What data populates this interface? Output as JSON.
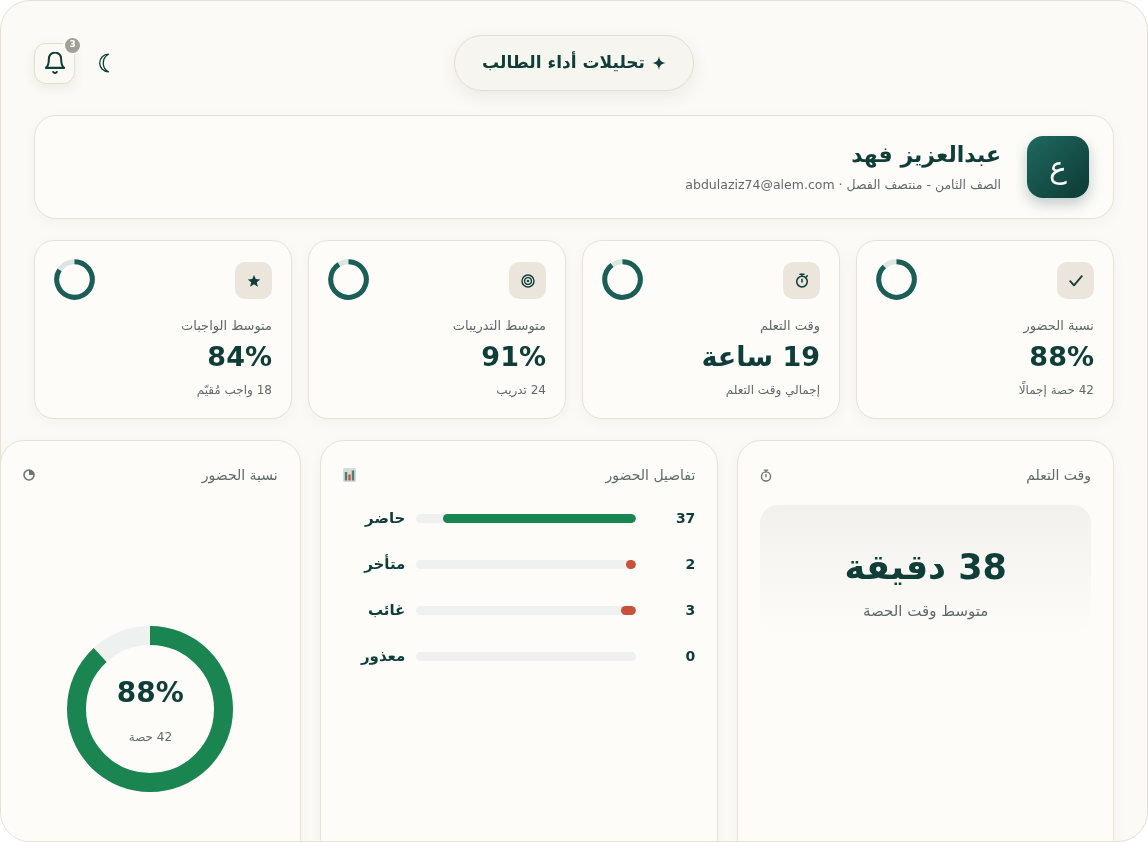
{
  "header": {
    "title": "تحليلات أداء الطالب",
    "notification_count": "3"
  },
  "profile": {
    "avatar": "ع",
    "name": "عبدالعزيز فهد",
    "subtitle": "الصف الثامن - منتصف الفصل · abdulaziz74@alem.com"
  },
  "stats": [
    {
      "kind": "check",
      "label": "نسبة الحضور",
      "value": "88%",
      "note": "42 حصة إجمالًا",
      "level": 0.88
    },
    {
      "kind": "stopwatch",
      "label": "وقت التعلم",
      "value": "19 ساعة",
      "note": "إجمالي وقت التعلم",
      "level": 0.9
    },
    {
      "kind": "target",
      "label": "متوسط التدريبات",
      "value": "91%",
      "note": "24 تدريب",
      "level": 0.91
    },
    {
      "kind": "star",
      "label": "متوسط الواجبات",
      "value": "84%",
      "note": "18 واجب مُقيّم",
      "level": 0.84
    }
  ],
  "learning_time": {
    "title": "وقت التعلم",
    "value": "38 دقيقة",
    "note": "متوسط وقت الحصة"
  },
  "attendance_details": {
    "title": "تفاصيل الحضور",
    "rows": [
      {
        "label": "حاضر",
        "count": "37",
        "level": 0.88,
        "color": "#1a8550"
      },
      {
        "label": "متأخر",
        "count": "2",
        "level": 0.048,
        "color": "#c9503a"
      },
      {
        "label": "غائب",
        "count": "3",
        "level": 0.071,
        "color": "#c9503a"
      },
      {
        "label": "معذور",
        "count": "0"
      }
    ]
  },
  "attendance_rate": {
    "title": "نسبة الحضور",
    "value": "88%",
    "note": "42 حصة",
    "level": 0.88
  }
}
